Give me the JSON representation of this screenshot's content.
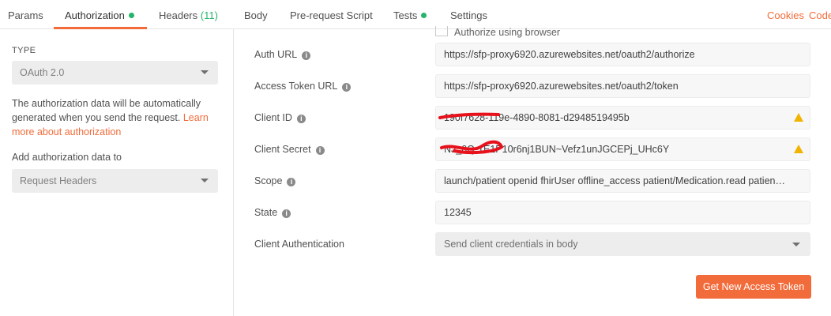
{
  "tabs": {
    "params": "Params",
    "authorization": "Authorization",
    "headers": "Headers",
    "headers_count": "(11)",
    "body": "Body",
    "prerequest": "Pre-request Script",
    "tests": "Tests",
    "settings": "Settings"
  },
  "top_links": {
    "cookies": "Cookies",
    "code": "Code"
  },
  "left": {
    "type_label": "TYPE",
    "type_value": "OAuth 2.0",
    "info_text": "The authorization data will be automatically generated when you send the request.",
    "learn_more": "Learn more about authorization",
    "add_to_label": "Add authorization data to",
    "add_to_value": "Request Headers"
  },
  "form": {
    "authorize_browser": "Authorize using browser",
    "auth_url_label": "Auth URL",
    "auth_url": "https://sfp-proxy6920.azurewebsites.net/oauth2/authorize",
    "token_url_label": "Access Token URL",
    "token_url": "https://sfp-proxy6920.azurewebsites.net/oauth2/token",
    "client_id_label": "Client ID",
    "client_id": "190f7628-119e-4890-8081-d2948519495b",
    "client_secret_label": "Client Secret",
    "client_secret": "NJ_0Q-1E1P10r6nj1BUN~Vefz1unJGCEPj_UHc6Y",
    "scope_label": "Scope",
    "scope": "launch/patient openid fhirUser offline_access patient/Medication.read patient/AllergyIntolerance.read",
    "state_label": "State",
    "state": "12345",
    "client_auth_label": "Client Authentication",
    "client_auth": "Send client credentials in body",
    "button": "Get New Access Token"
  },
  "colors": {
    "accent": "#f26b3a",
    "green": "#26b36b",
    "warning": "#f0b400",
    "redaction": "#e8101a"
  }
}
